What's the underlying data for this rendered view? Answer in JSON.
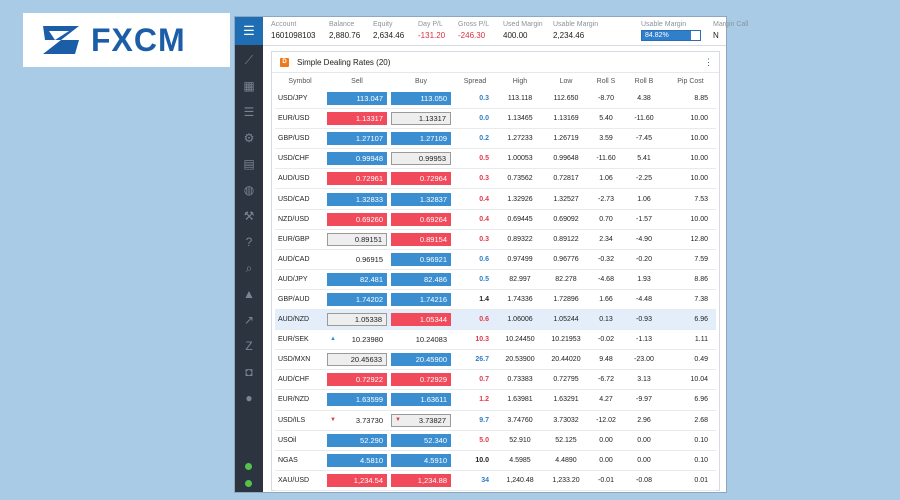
{
  "logo": {
    "text": "FXCM"
  },
  "account_bar": {
    "fields": [
      {
        "label": "Account",
        "value": "1601098103",
        "neg": false
      },
      {
        "label": "Balance",
        "value": "2,880.76",
        "neg": false
      },
      {
        "label": "Equity",
        "value": "2,634.46",
        "neg": false
      },
      {
        "label": "Day P/L",
        "value": "-131.20",
        "neg": true
      },
      {
        "label": "Gross P/L",
        "value": "-246.30",
        "neg": true
      },
      {
        "label": "Used Margin",
        "value": "400.00",
        "neg": false
      },
      {
        "label": "Usable Margin",
        "value": "2,234.46",
        "neg": false
      }
    ],
    "usable_margin_pct_label": "Usable Margin",
    "usable_margin_pct": "84.82%",
    "usable_margin_fraction": 0.8482,
    "margin_call_label": "Margin Call",
    "margin_call_value": "N"
  },
  "panel": {
    "title": "Simple Dealing Rates (20)",
    "menu": "⋮",
    "columns": [
      "Symbol",
      "Sell",
      "Buy",
      "Spread",
      "High",
      "Low",
      "Roll S",
      "Roll B",
      "Pip Cost"
    ],
    "rows": [
      {
        "symbol": "USD/JPY",
        "sell": "113.047",
        "sell_style": "blue",
        "sell_arrow": "",
        "buy": "113.050",
        "buy_style": "blue",
        "buy_arrow": "",
        "spread": "0.3",
        "spread_color": "blue",
        "high": "113.118",
        "low": "112.650",
        "roll_s": "-8.70",
        "roll_b": "4.38",
        "pip": "8.85"
      },
      {
        "symbol": "EUR/USD",
        "sell": "1.13317",
        "sell_style": "red",
        "sell_arrow": "",
        "buy": "1.13317",
        "buy_style": "gray",
        "buy_arrow": "",
        "spread": "0.0",
        "spread_color": "blue",
        "high": "1.13465",
        "low": "1.13169",
        "roll_s": "5.40",
        "roll_b": "-11.60",
        "pip": "10.00"
      },
      {
        "symbol": "GBP/USD",
        "sell": "1.27107",
        "sell_style": "blue",
        "sell_arrow": "",
        "buy": "1.27109",
        "buy_style": "blue",
        "buy_arrow": "",
        "spread": "0.2",
        "spread_color": "blue",
        "high": "1.27233",
        "low": "1.26719",
        "roll_s": "3.59",
        "roll_b": "-7.45",
        "pip": "10.00"
      },
      {
        "symbol": "USD/CHF",
        "sell": "0.99948",
        "sell_style": "blue",
        "sell_arrow": "",
        "buy": "0.99953",
        "buy_style": "gray",
        "buy_arrow": "",
        "spread": "0.5",
        "spread_color": "red",
        "high": "1.00053",
        "low": "0.99648",
        "roll_s": "-11.60",
        "roll_b": "5.41",
        "pip": "10.00"
      },
      {
        "symbol": "AUD/USD",
        "sell": "0.72961",
        "sell_style": "red",
        "sell_arrow": "",
        "buy": "0.72964",
        "buy_style": "red",
        "buy_arrow": "",
        "spread": "0.3",
        "spread_color": "red",
        "high": "0.73562",
        "low": "0.72817",
        "roll_s": "1.06",
        "roll_b": "-2.25",
        "pip": "10.00"
      },
      {
        "symbol": "USD/CAD",
        "sell": "1.32833",
        "sell_style": "blue",
        "sell_arrow": "",
        "buy": "1.32837",
        "buy_style": "blue",
        "buy_arrow": "",
        "spread": "0.4",
        "spread_color": "red",
        "high": "1.32926",
        "low": "1.32527",
        "roll_s": "-2.73",
        "roll_b": "1.06",
        "pip": "7.53"
      },
      {
        "symbol": "NZD/USD",
        "sell": "0.69260",
        "sell_style": "red",
        "sell_arrow": "",
        "buy": "0.69264",
        "buy_style": "red",
        "buy_arrow": "",
        "spread": "0.4",
        "spread_color": "red",
        "high": "0.69445",
        "low": "0.69092",
        "roll_s": "0.70",
        "roll_b": "-1.57",
        "pip": "10.00"
      },
      {
        "symbol": "EUR/GBP",
        "sell": "0.89151",
        "sell_style": "gray",
        "sell_arrow": "",
        "buy": "0.89154",
        "buy_style": "red",
        "buy_arrow": "",
        "spread": "0.3",
        "spread_color": "red",
        "high": "0.89322",
        "low": "0.89122",
        "roll_s": "2.34",
        "roll_b": "-4.90",
        "pip": "12.80"
      },
      {
        "symbol": "AUD/CAD",
        "sell": "0.96915",
        "sell_style": "white",
        "sell_arrow": "",
        "buy": "0.96921",
        "buy_style": "blue",
        "buy_arrow": "",
        "spread": "0.6",
        "spread_color": "blue",
        "high": "0.97499",
        "low": "0.96776",
        "roll_s": "-0.32",
        "roll_b": "-0.20",
        "pip": "7.59"
      },
      {
        "symbol": "AUD/JPY",
        "sell": "82.481",
        "sell_style": "blue",
        "sell_arrow": "",
        "buy": "82.486",
        "buy_style": "blue",
        "buy_arrow": "",
        "spread": "0.5",
        "spread_color": "blue",
        "high": "82.997",
        "low": "82.278",
        "roll_s": "-4.68",
        "roll_b": "1.93",
        "pip": "8.86"
      },
      {
        "symbol": "GBP/AUD",
        "sell": "1.74202",
        "sell_style": "blue",
        "sell_arrow": "",
        "buy": "1.74216",
        "buy_style": "blue",
        "buy_arrow": "",
        "spread": "1.4",
        "spread_color": "black",
        "high": "1.74336",
        "low": "1.72896",
        "roll_s": "1.66",
        "roll_b": "-4.48",
        "pip": "7.38"
      },
      {
        "symbol": "AUD/NZD",
        "sell": "1.05338",
        "sell_style": "gray",
        "sell_arrow": "",
        "buy": "1.05344",
        "buy_style": "red",
        "buy_arrow": "",
        "spread": "0.6",
        "spread_color": "red",
        "high": "1.06006",
        "low": "1.05244",
        "roll_s": "0.13",
        "roll_b": "-0.93",
        "pip": "6.96"
      },
      {
        "symbol": "EUR/SEK",
        "sell": "10.23980",
        "sell_style": "white",
        "sell_arrow": "up",
        "buy": "10.24083",
        "buy_style": "white",
        "buy_arrow": "",
        "spread": "10.3",
        "spread_color": "red",
        "high": "10.24450",
        "low": "10.21953",
        "roll_s": "-0.02",
        "roll_b": "-1.13",
        "pip": "1.11"
      },
      {
        "symbol": "USD/MXN",
        "sell": "20.45633",
        "sell_style": "gray",
        "sell_arrow": "",
        "buy": "20.45900",
        "buy_style": "blue",
        "buy_arrow": "",
        "spread": "26.7",
        "spread_color": "blue",
        "high": "20.53900",
        "low": "20.44020",
        "roll_s": "9.48",
        "roll_b": "-23.00",
        "pip": "0.49"
      },
      {
        "symbol": "AUD/CHF",
        "sell": "0.72922",
        "sell_style": "red",
        "sell_arrow": "",
        "buy": "0.72929",
        "buy_style": "red",
        "buy_arrow": "",
        "spread": "0.7",
        "spread_color": "red",
        "high": "0.73383",
        "low": "0.72795",
        "roll_s": "-6.72",
        "roll_b": "3.13",
        "pip": "10.04"
      },
      {
        "symbol": "EUR/NZD",
        "sell": "1.63599",
        "sell_style": "blue",
        "sell_arrow": "",
        "buy": "1.63611",
        "buy_style": "blue",
        "buy_arrow": "",
        "spread": "1.2",
        "spread_color": "red",
        "high": "1.63981",
        "low": "1.63291",
        "roll_s": "4.27",
        "roll_b": "-9.97",
        "pip": "6.96"
      },
      {
        "symbol": "USD/ILS",
        "sell": "3.73730",
        "sell_style": "white",
        "sell_arrow": "down",
        "buy": "3.73827",
        "buy_style": "gray",
        "buy_arrow": "down",
        "spread": "9.7",
        "spread_color": "blue",
        "high": "3.74760",
        "low": "3.73032",
        "roll_s": "-12.02",
        "roll_b": "2.96",
        "pip": "2.68"
      },
      {
        "symbol": "USOil",
        "sell": "52.290",
        "sell_style": "blue",
        "sell_arrow": "",
        "buy": "52.340",
        "buy_style": "blue",
        "buy_arrow": "",
        "spread": "5.0",
        "spread_color": "red",
        "high": "52.910",
        "low": "52.125",
        "roll_s": "0.00",
        "roll_b": "0.00",
        "pip": "0.10"
      },
      {
        "symbol": "NGAS",
        "sell": "4.5810",
        "sell_style": "blue",
        "sell_arrow": "",
        "buy": "4.5910",
        "buy_style": "blue",
        "buy_arrow": "",
        "spread": "10.0",
        "spread_color": "black",
        "high": "4.5985",
        "low": "4.4890",
        "roll_s": "0.00",
        "roll_b": "0.00",
        "pip": "0.10"
      },
      {
        "symbol": "XAU/USD",
        "sell": "1,234.54",
        "sell_style": "red",
        "sell_arrow": "",
        "buy": "1,234.88",
        "buy_style": "red",
        "buy_arrow": "",
        "spread": "34",
        "spread_color": "blue",
        "high": "1,240.48",
        "low": "1,233.20",
        "roll_s": "-0.01",
        "roll_b": "-0.08",
        "pip": "0.01"
      }
    ],
    "highlighted_symbol": "AUD/NZD"
  },
  "sidebar": {
    "menu_icon": "☰",
    "icons": [
      "chart-line-icon",
      "grid-icon",
      "list-icon",
      "gear-icon",
      "document-icon",
      "globe-icon",
      "tools-icon",
      "help-icon",
      "search-doc-icon",
      "graduation-icon",
      "trend-icon",
      "fxcm-z-icon",
      "chat-icon",
      "user-icon"
    ],
    "status_dots_color": "#57c24b"
  }
}
